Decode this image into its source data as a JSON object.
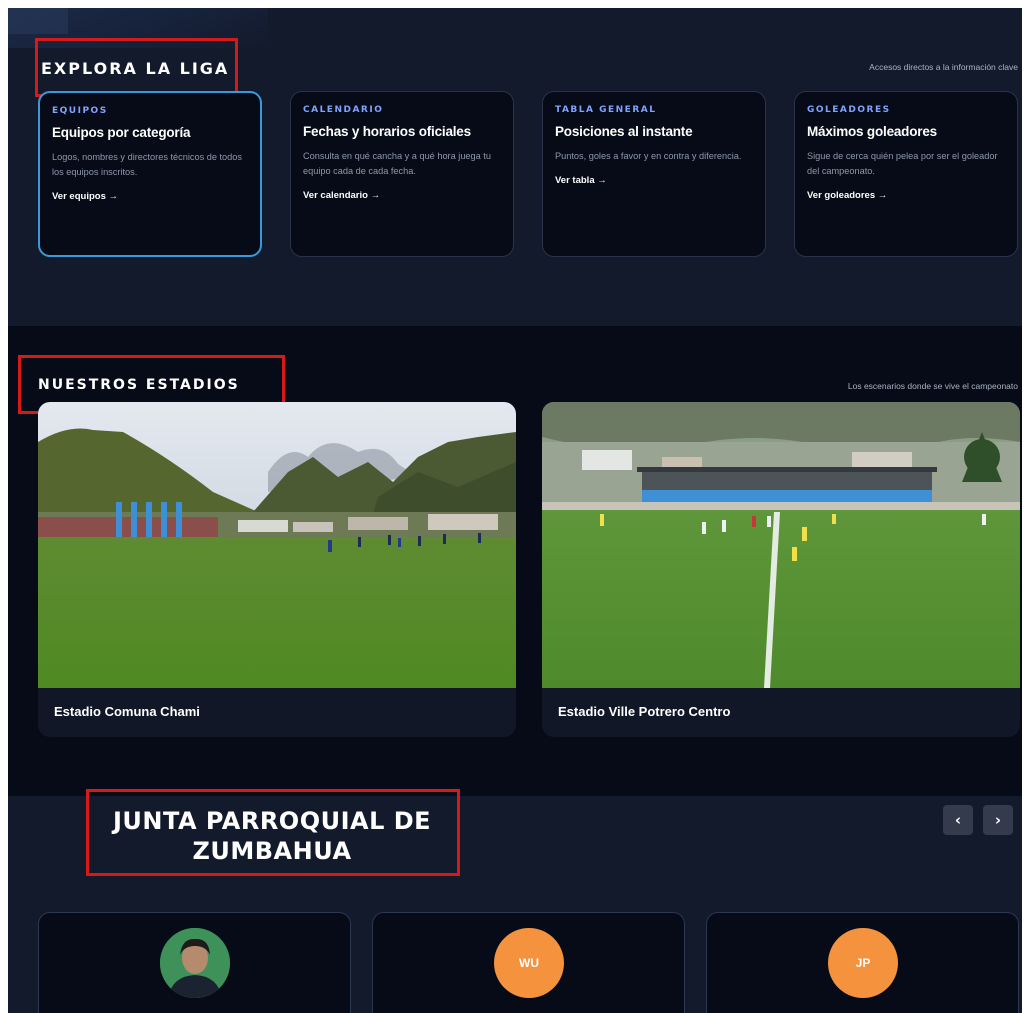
{
  "explora": {
    "title": "EXPLORA LA LIGA",
    "subtitle": "Accesos directos a la información clave",
    "cards": [
      {
        "tag": "EQUIPOS",
        "title": "Equipos por categoría",
        "description": "Logos, nombres y directores técnicos de todos los equipos inscritos.",
        "link": "Ver equipos →"
      },
      {
        "tag": "CALENDARIO",
        "title": "Fechas y horarios oficiales",
        "description": "Consulta en qué cancha y a qué hora juega tu equipo cada de cada fecha.",
        "link": "Ver calendario →"
      },
      {
        "tag": "TABLA GENERAL",
        "title": "Posiciones al instante",
        "description": "Puntos, goles a favor y en contra y diferencia.",
        "link": "Ver tabla →"
      },
      {
        "tag": "GOLEADORES",
        "title": "Máximos goleadores",
        "description": "Sigue de cerca quién pelea por ser el goleador del campeonato.",
        "link": "Ver goleadores →"
      }
    ]
  },
  "estadios": {
    "title": "NUESTROS ESTADIOS",
    "subtitle": "Los escenarios donde se vive el campeonato",
    "items": [
      {
        "name": "Estadio Comuna Chami"
      },
      {
        "name": "Estadio Ville Potrero Centro"
      }
    ]
  },
  "junta": {
    "title": "JUNTA PARROQUIAL DE ZUMBAHUA",
    "prev_label": "‹",
    "next_label": "›",
    "members": [
      {
        "initials": "",
        "avatar": "photo",
        "name": ""
      },
      {
        "initials": "WU",
        "avatar": "initials",
        "name": ""
      },
      {
        "initials": "JP",
        "avatar": "initials",
        "name": ""
      }
    ]
  },
  "colors": {
    "accent_blue": "#3a9ad9",
    "tag_blue": "#7fa3ff",
    "highlight_red": "#d61a1a",
    "avatar_orange": "#f4923d"
  }
}
